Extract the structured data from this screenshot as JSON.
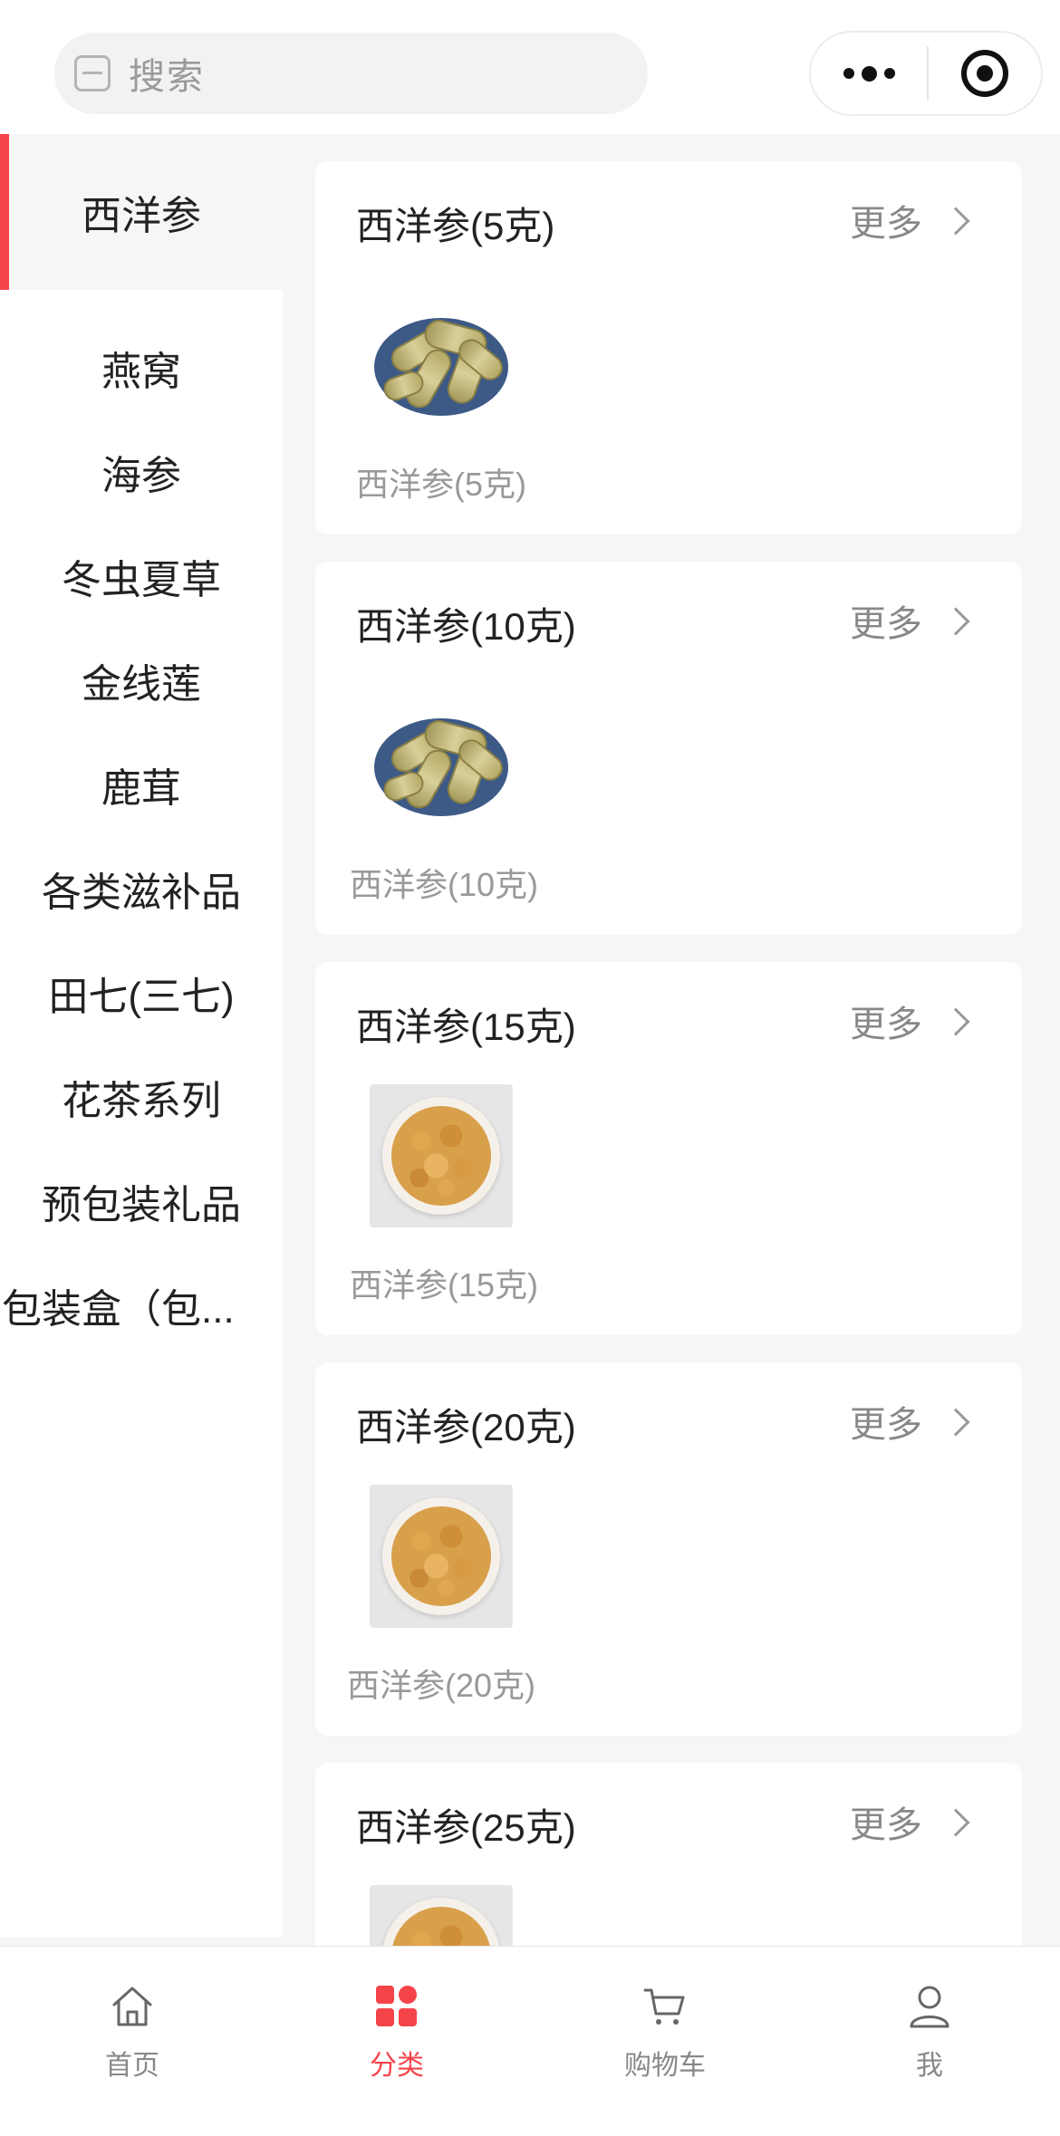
{
  "search": {
    "placeholder": "搜索"
  },
  "capsule": {
    "more_icon": "more-dots-icon",
    "close_icon": "target-close-icon"
  },
  "sidebar": {
    "items": [
      {
        "label": "西洋参",
        "active": true
      },
      {
        "label": "燕窝"
      },
      {
        "label": "海参"
      },
      {
        "label": "冬虫夏草"
      },
      {
        "label": "金线莲"
      },
      {
        "label": "鹿茸"
      },
      {
        "label": "各类滋补品"
      },
      {
        "label": "田七(三七)"
      },
      {
        "label": "花茶系列"
      },
      {
        "label": "预包装礼品"
      },
      {
        "label": "包装盒（包..."
      }
    ]
  },
  "cards": [
    {
      "title": "西洋参(5克)",
      "more": "更多",
      "label": "西洋参(5克)",
      "photo": "plate"
    },
    {
      "title": "西洋参(10克)",
      "more": "更多",
      "label": "西洋参(10克)",
      "photo": "plate"
    },
    {
      "title": "西洋参(15克)",
      "more": "更多",
      "label": "西洋参(15克)",
      "photo": "bowl"
    },
    {
      "title": "西洋参(20克)",
      "more": "更多",
      "label": "西洋参(20克)",
      "photo": "bowl"
    },
    {
      "title": "西洋参(25克)",
      "more": "更多",
      "label": "",
      "photo": "bowl"
    }
  ],
  "tabbar": {
    "items": [
      {
        "label": "首页",
        "icon": "home-icon"
      },
      {
        "label": "分类",
        "icon": "category-icon",
        "active": true
      },
      {
        "label": "购物车",
        "icon": "cart-icon"
      },
      {
        "label": "我",
        "icon": "user-icon"
      }
    ]
  },
  "colors": {
    "accent": "#f5434a",
    "background": "#f6f6f6"
  }
}
